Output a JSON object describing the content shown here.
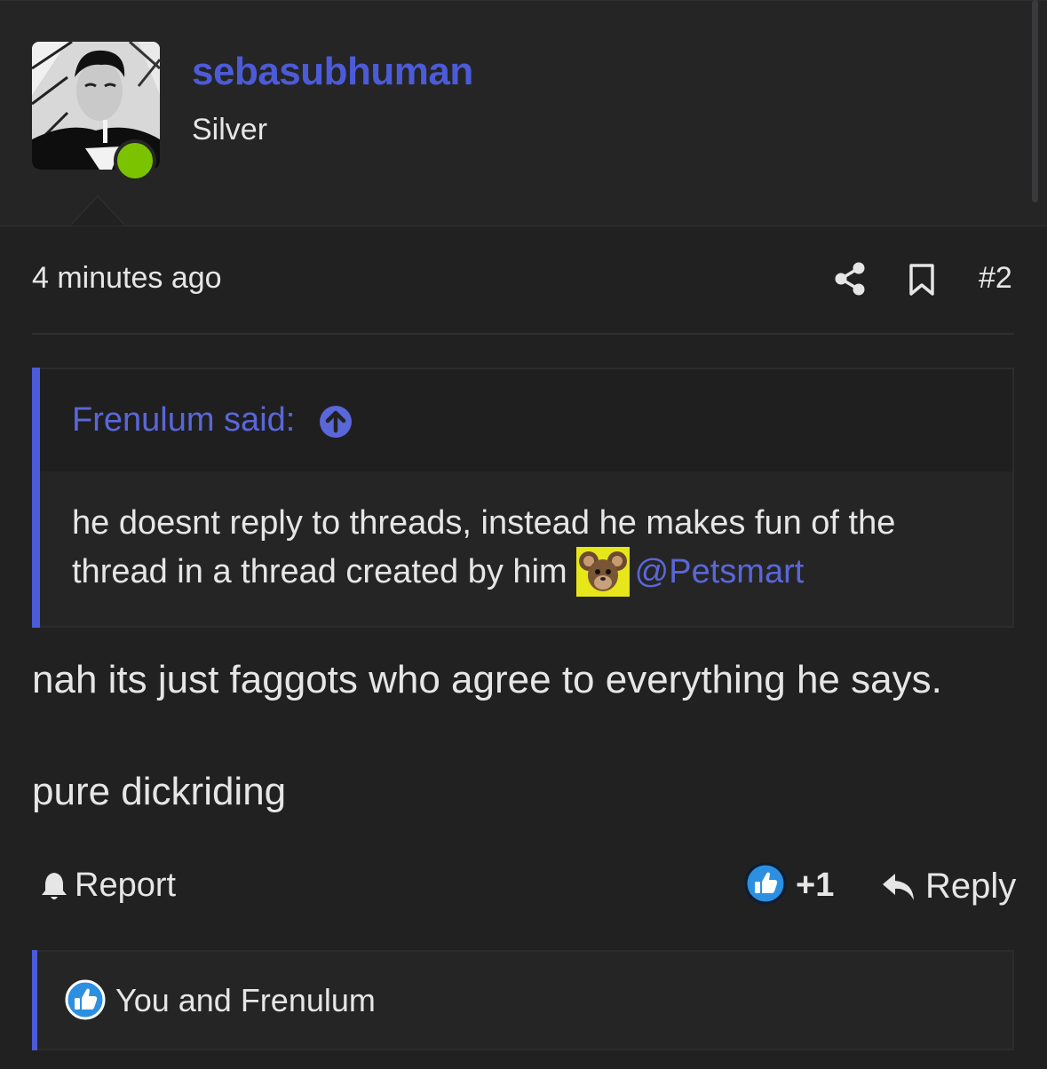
{
  "user": {
    "name": "sebasubhuman",
    "title": "Silver",
    "online": true
  },
  "post": {
    "time": "4 minutes ago",
    "number": "#2",
    "body": [
      "nah its just faggots who agree to everything he says.",
      "pure dickriding"
    ]
  },
  "quote": {
    "author_label": "Frenulum said:",
    "line1": "he doesnt reply to threads, instead he makes fun of the",
    "line2_prefix": "thread in a thread created by him",
    "mention": "@Petsmart"
  },
  "actions": {
    "report_label": "Report",
    "like_count": "+1",
    "reply_label": "Reply"
  },
  "reactions": {
    "text": "You and Frenulum"
  },
  "colors": {
    "accent": "#4c5bd8",
    "online": "#7bc300",
    "like": "#2d8fe0",
    "background": "#212122"
  },
  "icons": [
    "share-icon",
    "bookmark-icon",
    "arrow-up-circle-icon",
    "bell-icon",
    "thumbs-up-icon",
    "reply-arrow-icon"
  ]
}
